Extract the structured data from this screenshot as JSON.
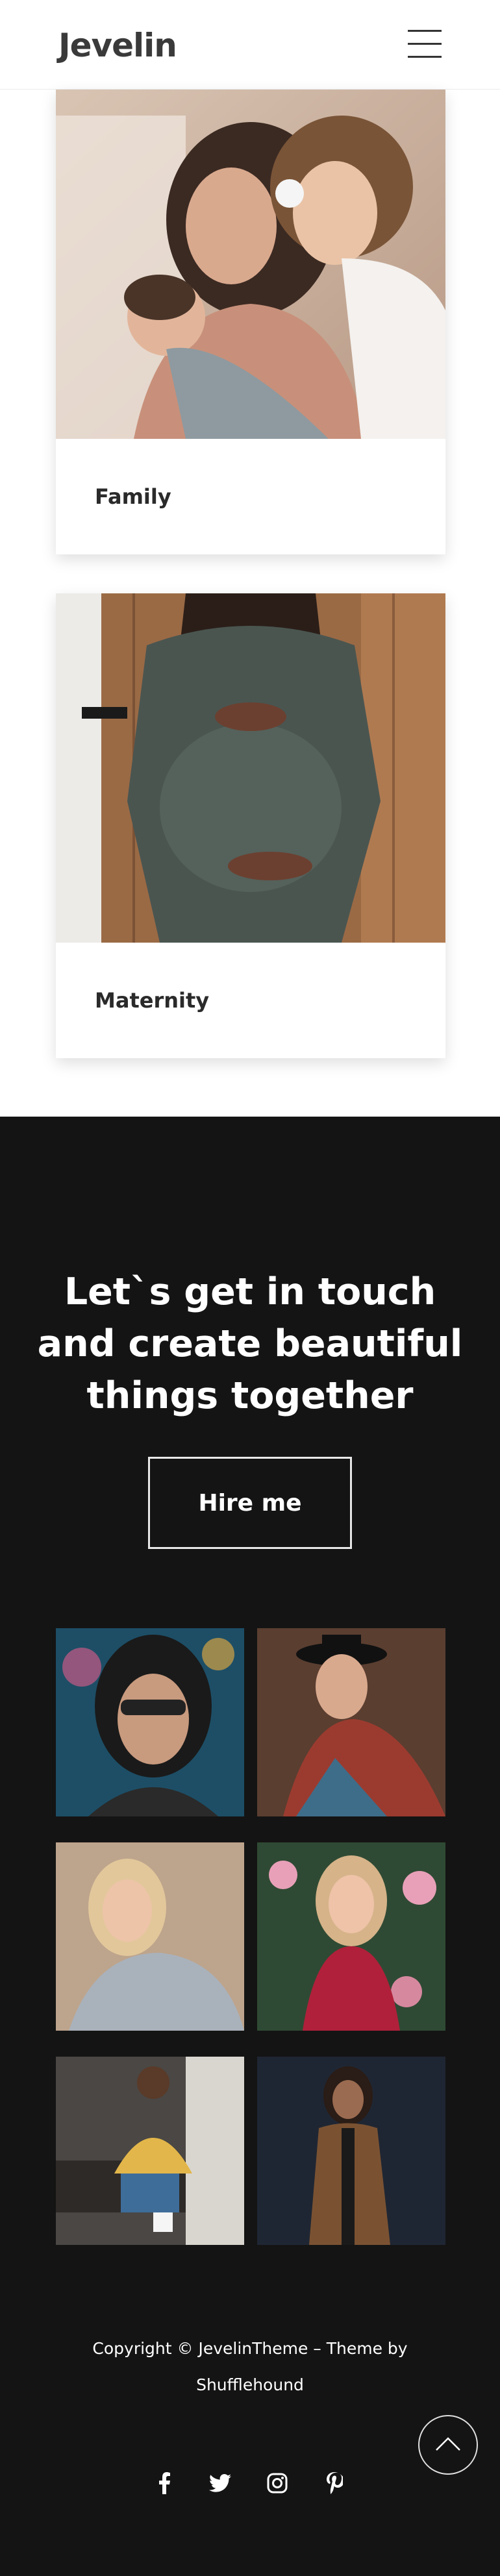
{
  "header": {
    "logo": "Jevelin",
    "menu_icon": "hamburger-menu-icon"
  },
  "cards": [
    {
      "title": "Family",
      "image": "mother-with-children-photo"
    },
    {
      "title": "Maternity",
      "image": "pregnant-woman-photo"
    }
  ],
  "cta": {
    "heading": "Let`s get in touch and create beautiful things together",
    "button_label": "Hire me"
  },
  "gallery": [
    "woman-sunglasses-neon-photo",
    "woman-black-hat-photo",
    "blonde-woman-sweater-photo",
    "woman-red-dress-flowers-photo",
    "man-sitting-colorful-shirt-photo",
    "woman-brown-coat-photo"
  ],
  "footer": {
    "copyright_line1": "Copyright © JevelinTheme – Theme by",
    "copyright_line2": "Shufflehound",
    "social": [
      "facebook-icon",
      "twitter-icon",
      "instagram-icon",
      "pinterest-icon"
    ],
    "back_to_top_icon": "chevron-up-icon"
  },
  "colors": {
    "dark_bg": "#141414",
    "text_dark": "#2a2a2a",
    "white": "#ffffff"
  }
}
